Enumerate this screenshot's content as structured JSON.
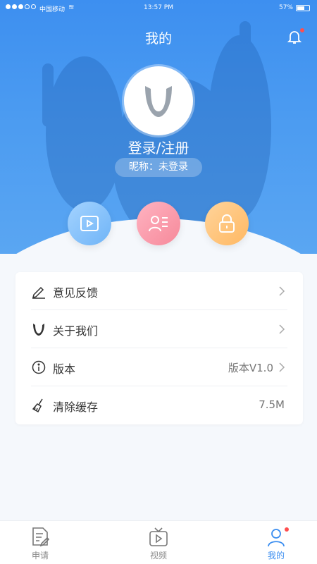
{
  "status": {
    "carrier": "中国移动",
    "time": "13:57 PM",
    "battery": "57%"
  },
  "header": {
    "title": "我的"
  },
  "profile": {
    "login": "登录/注册",
    "nickname": "昵称：未登录"
  },
  "quick_actions": [
    {
      "icon": "video-icon"
    },
    {
      "icon": "id-card-icon"
    },
    {
      "icon": "lock-icon"
    }
  ],
  "menu": [
    {
      "label": "意见反馈",
      "icon": "pen-icon",
      "value": ""
    },
    {
      "label": "关于我们",
      "icon": "logo-u-icon",
      "value": ""
    },
    {
      "label": "版本",
      "icon": "info-icon",
      "value": "版本V1.0"
    },
    {
      "label": "清除缓存",
      "icon": "broom-icon",
      "value": "7.5M"
    }
  ],
  "tabs": [
    {
      "label": "申请",
      "icon": "document-edit-icon"
    },
    {
      "label": "视频",
      "icon": "tv-icon"
    },
    {
      "label": "我的",
      "icon": "user-icon",
      "active": true
    }
  ],
  "colors": {
    "accent": "#3a8df0",
    "badge": "#ff4e4e"
  }
}
